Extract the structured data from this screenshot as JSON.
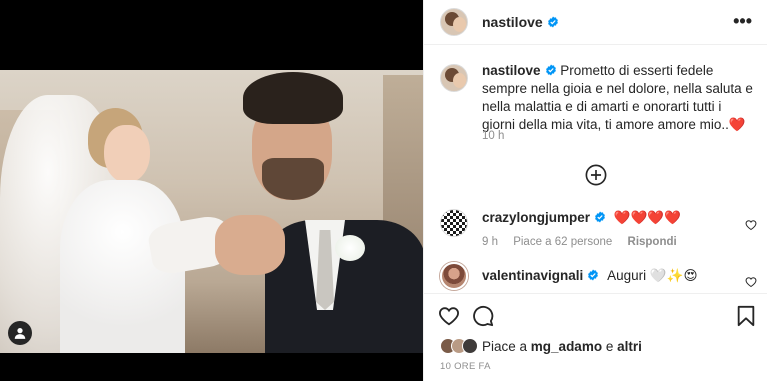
{
  "post": {
    "username": "nastilove",
    "caption": "Prometto di esserti fedele sempre nella gioia e nel dolore, nella saluta e nella malattia e di amarti e onorarti tutti i giorni della mia vita, ti amore amore mio..❤️",
    "caption_time": "10 h",
    "post_time": "10 ORE FA"
  },
  "comments": [
    {
      "username": "crazylongjumper",
      "text": "❤️❤️❤️❤️",
      "time": "9 h",
      "likes": "Piace a 62 persone",
      "reply": "Rispondi"
    },
    {
      "username": "valentinavignali",
      "text": "Auguri 🤍✨😍"
    }
  ],
  "likes": {
    "prefix": "Piace a",
    "user": "mg_adamo",
    "joiner": "e",
    "others": "altri"
  },
  "colors": {
    "verified": "#0095f6",
    "heart": "#ed4956",
    "text": "#262626",
    "muted": "#8e8e8e"
  },
  "icons": [
    "more-icon",
    "verified-icon",
    "add-comment-icon",
    "like-icon",
    "comment-icon",
    "save-icon",
    "user-tag-icon"
  ]
}
